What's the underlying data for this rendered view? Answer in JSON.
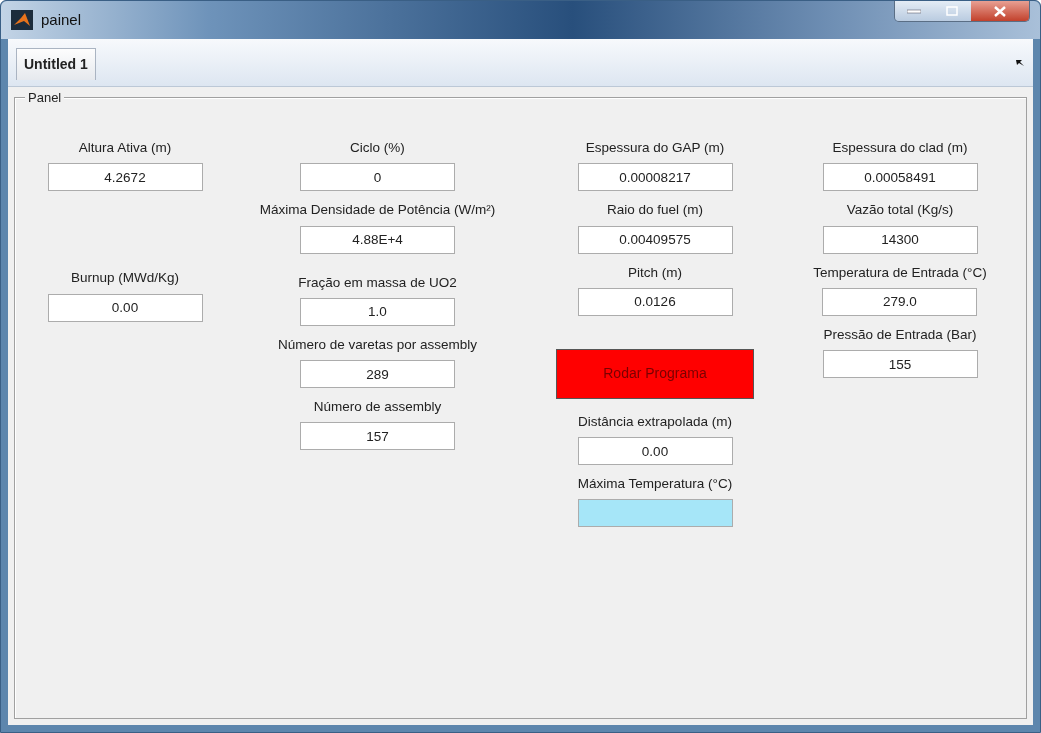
{
  "window": {
    "title": "painel"
  },
  "tabs": [
    {
      "label": "Untitled 1"
    }
  ],
  "panel": {
    "title": "Panel",
    "columns": [
      {
        "items": [
          {
            "kind": "field",
            "label": "Altura Ativa (m)",
            "value": "4.2672"
          },
          {
            "kind": "field",
            "label": "Burnup (MWd/Kg)",
            "value": "0.00"
          }
        ]
      },
      {
        "items": [
          {
            "kind": "field",
            "label": "Ciclo (%)",
            "value": "0"
          },
          {
            "kind": "field",
            "label": "Máxima Densidade de Potência (W/m²)",
            "value": "4.88E+4"
          },
          {
            "kind": "field",
            "label": "Fração em massa de UO2",
            "value": "1.0"
          },
          {
            "kind": "field",
            "label": "Número de varetas por assembly",
            "value": "289"
          },
          {
            "kind": "field",
            "label": "Número de assembly",
            "value": "157"
          }
        ]
      },
      {
        "items": [
          {
            "kind": "field",
            "label": "Espessura do GAP (m)",
            "value": "0.00008217"
          },
          {
            "kind": "field",
            "label": "Raio do fuel (m)",
            "value": "0.00409575"
          },
          {
            "kind": "field",
            "label": "Pitch (m)",
            "value": "0.0126"
          },
          {
            "kind": "button",
            "label": "Rodar Programa"
          },
          {
            "kind": "field",
            "label": "Distância extrapolada (m)",
            "value": "0.00"
          },
          {
            "kind": "readout",
            "label": "Máxima Temperatura (°C)"
          }
        ]
      },
      {
        "items": [
          {
            "kind": "field",
            "label": "Espessura do clad (m)",
            "value": "0.00058491"
          },
          {
            "kind": "field",
            "label": "Vazão total (Kg/s)",
            "value": "14300"
          },
          {
            "kind": "field",
            "label": "Temperatura de Entrada (°C)",
            "value": "279.0"
          },
          {
            "kind": "field",
            "label": "Pressão de Entrada (Bar)",
            "value": "155"
          }
        ]
      }
    ]
  }
}
